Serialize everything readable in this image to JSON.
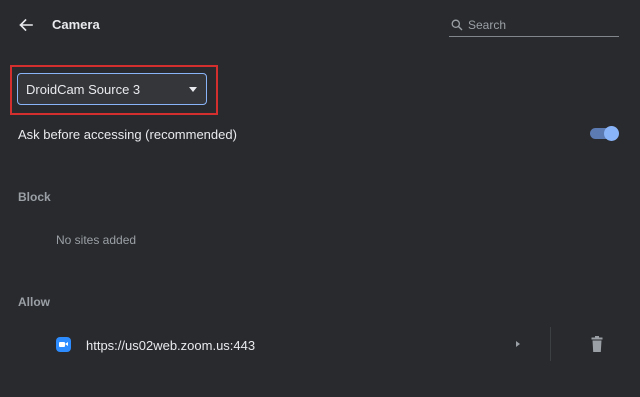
{
  "header": {
    "title": "Camera",
    "back_icon": "arrow-back-icon",
    "search_icon": "search-icon",
    "search_placeholder": "Search"
  },
  "camera_select": {
    "selected": "DroidCam Source 3",
    "highlight_color": "#d32f2f"
  },
  "ask_setting": {
    "label": "Ask before accessing (recommended)",
    "enabled": true,
    "accent_color": "#8ab4f8"
  },
  "block": {
    "heading": "Block",
    "empty_text": "No sites added"
  },
  "allow": {
    "heading": "Allow",
    "sites": [
      {
        "url": "https://us02web.zoom.us:443",
        "favicon": "zoom-camera-icon"
      }
    ]
  }
}
